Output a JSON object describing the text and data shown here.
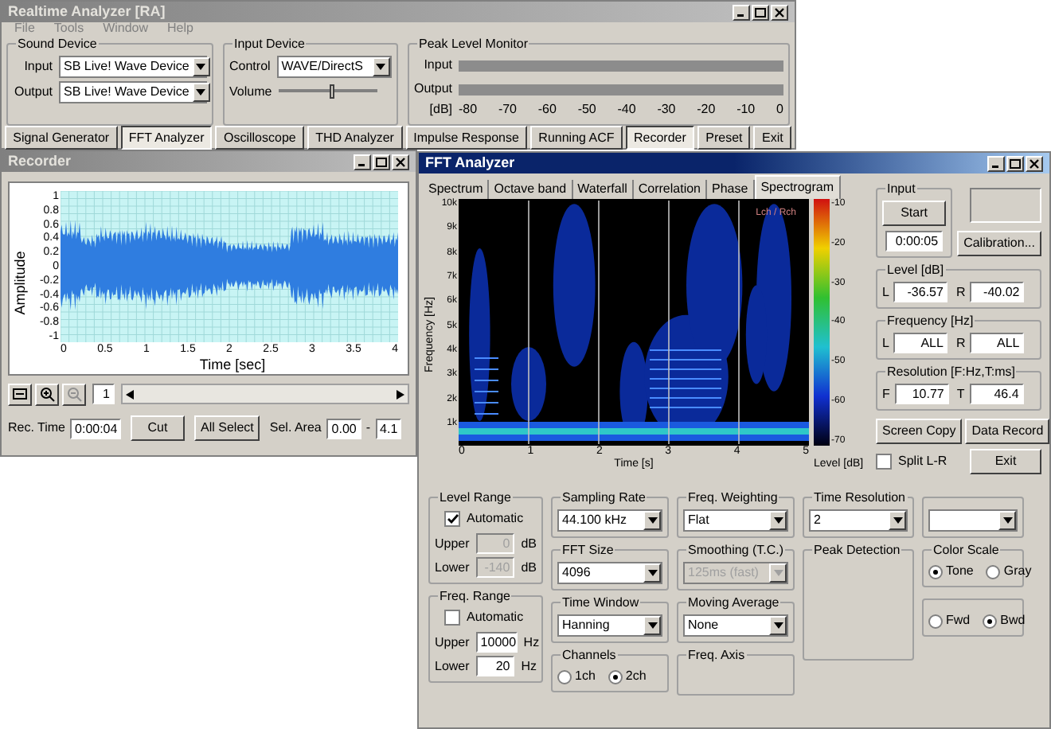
{
  "main_window": {
    "title": "Realtime Analyzer [RA]",
    "menu": [
      "File",
      "Tools",
      "Window",
      "Help"
    ],
    "sound_device": {
      "label": "Sound Device",
      "input_label": "Input",
      "input_value": "SB Live! Wave Device",
      "output_label": "Output",
      "output_value": "SB Live! Wave Device"
    },
    "input_device": {
      "label": "Input Device",
      "control_label": "Control",
      "control_value": "WAVE/DirectS",
      "volume_label": "Volume",
      "volume": {
        "level": 0.55
      }
    },
    "peak_level_monitor": {
      "label": "Peak Level Monitor",
      "input_label": "Input",
      "output_label": "Output",
      "unit": "[dB]",
      "scale": [
        "-80",
        "-70",
        "-60",
        "-50",
        "-40",
        "-30",
        "-20",
        "-10",
        "0"
      ]
    },
    "tool_tabs": [
      {
        "label": "Signal Generator",
        "selected": false
      },
      {
        "label": "FFT Analyzer",
        "selected": true
      },
      {
        "label": "Oscilloscope",
        "selected": false
      },
      {
        "label": "THD Analyzer",
        "selected": false
      },
      {
        "label": "Impulse Response",
        "selected": false
      },
      {
        "label": "Running ACF",
        "selected": false
      },
      {
        "label": "Recorder",
        "selected": true
      },
      {
        "label": "Preset",
        "selected": false
      },
      {
        "label": "Exit",
        "selected": false
      }
    ]
  },
  "recorder": {
    "title": "Recorder",
    "y_label": "Amplitude",
    "y_ticks": [
      "1",
      "0.8",
      "0.6",
      "0.4",
      "0.2",
      "0",
      "-0.2",
      "-0.4",
      "-0.6",
      "-0.8",
      "-1"
    ],
    "x_ticks": [
      "0",
      "0.5",
      "1",
      "1.5",
      "2",
      "2.5",
      "3",
      "3.5",
      "4"
    ],
    "x_label": "Time [sec]",
    "page": "1",
    "rec_time_label": "Rec. Time",
    "rec_time": "0:00:04",
    "buttons": [
      "Cut",
      "All Select"
    ],
    "sel_area_label": "Sel. Area",
    "sel_from": "0.00",
    "sel_separator": "-",
    "sel_to": "4.1"
  },
  "fft_analyzer": {
    "title": "FFT Analyzer",
    "tabs": [
      {
        "label": "Spectrum",
        "selected": false
      },
      {
        "label": "Octave band",
        "selected": false
      },
      {
        "label": "Waterfall",
        "selected": false
      },
      {
        "label": "Correlation",
        "selected": false
      },
      {
        "label": "Phase",
        "selected": false
      },
      {
        "label": "Spectrogram",
        "selected": true
      }
    ],
    "spectrogram": {
      "y_label": "Frequency [Hz]",
      "y_ticks": [
        "10k",
        "9k",
        "8k",
        "7k",
        "6k",
        "5k",
        "4k",
        "3k",
        "2k",
        "1k"
      ],
      "x_ticks": [
        "0",
        "1",
        "2",
        "3",
        "4",
        "5"
      ],
      "x_label": "Time [s]",
      "legend": "Lch / Rch",
      "level_ticks": [
        "-10",
        "-20",
        "-30",
        "-40",
        "-50",
        "-60",
        "-70"
      ],
      "level_label": "Level [dB]"
    },
    "input": {
      "label": "Input",
      "start": "Start",
      "time": "0:00:05",
      "calibration": "Calibration..."
    },
    "level": {
      "label": "Level [dB]",
      "l_label": "L",
      "l_value": "-36.57",
      "r_label": "R",
      "r_value": "-40.02"
    },
    "frequency": {
      "label": "Frequency [Hz]",
      "l_label": "L",
      "l_value": "ALL",
      "r_label": "R",
      "r_value": "ALL"
    },
    "resolution": {
      "label": "Resolution [F:Hz,T:ms]",
      "f_label": "F",
      "f_value": "10.77",
      "t_label": "T",
      "t_value": "46.4"
    },
    "buttons": [
      "Screen Copy",
      "Data Record"
    ],
    "split": {
      "label": "Split L-R",
      "checked": false
    },
    "exit": "Exit",
    "level_range": {
      "label": "Level Range",
      "automatic": {
        "label": "Automatic",
        "checked": true
      },
      "upper_label": "Upper",
      "upper": "0",
      "upper_unit": "dB",
      "lower_label": "Lower",
      "lower": "-140",
      "lower_unit": "dB",
      "disabled": true
    },
    "freq_range": {
      "label": "Freq. Range",
      "automatic": {
        "label": "Automatic",
        "checked": false
      },
      "upper_label": "Upper",
      "upper": "10000",
      "upper_unit": "Hz",
      "lower_label": "Lower",
      "lower": "20",
      "lower_unit": "Hz",
      "disabled": false
    },
    "sampling_rate": {
      "label": "Sampling Rate",
      "value": "44.100 kHz",
      "disabled": false
    },
    "fft_size": {
      "label": "FFT Size",
      "value": "4096",
      "disabled": false
    },
    "time_window": {
      "label": "Time Window",
      "value": "Hanning",
      "disabled": false
    },
    "channels": {
      "label": "Channels",
      "options": [
        {
          "label": "1ch",
          "selected": false
        },
        {
          "label": "2ch",
          "selected": true
        }
      ]
    },
    "freq_weighting": {
      "label": "Freq. Weighting",
      "value": "Flat",
      "disabled": false
    },
    "smoothing": {
      "label": "Smoothing (T.C.)",
      "value": "125ms (fast)",
      "disabled": true
    },
    "moving_average": {
      "label": "Moving Average",
      "value": "None",
      "disabled": false
    },
    "freq_axis": {
      "label": "Freq. Axis"
    },
    "time_resolution": {
      "label": "Time Resolution",
      "value": "2",
      "disabled": false
    },
    "peak_detection": {
      "label": "Peak Detection"
    },
    "color_scale": {
      "label": "Color Scale",
      "options": [
        {
          "label": "Tone",
          "selected": true
        },
        {
          "label": "Gray",
          "selected": false
        }
      ]
    },
    "axis_direction": {
      "options": [
        {
          "label": "Fwd",
          "selected": false
        },
        {
          "label": "Bwd",
          "selected": true
        }
      ]
    }
  }
}
